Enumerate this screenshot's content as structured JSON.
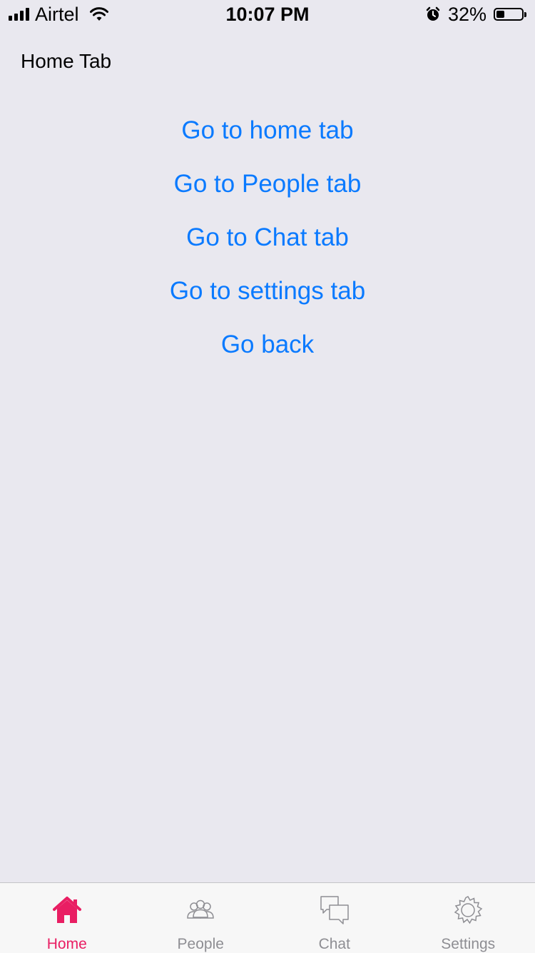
{
  "status_bar": {
    "carrier": "Airtel",
    "time": "10:07 PM",
    "battery_percent": "32%",
    "battery_level": 0.32,
    "icons": [
      "signal-icon",
      "wifi-icon",
      "alarm-icon",
      "battery-icon"
    ]
  },
  "screen": {
    "title": "Home Tab"
  },
  "links": [
    {
      "label": "Go to home tab"
    },
    {
      "label": "Go to People tab"
    },
    {
      "label": "Go to Chat tab"
    },
    {
      "label": "Go to settings tab"
    },
    {
      "label": "Go back"
    }
  ],
  "tab_bar": {
    "tabs": [
      {
        "label": "Home",
        "icon": "home-icon",
        "active": true
      },
      {
        "label": "People",
        "icon": "people-icon",
        "active": false
      },
      {
        "label": "Chat",
        "icon": "chat-icon",
        "active": false
      },
      {
        "label": "Settings",
        "icon": "gear-icon",
        "active": false
      }
    ]
  },
  "colors": {
    "background": "#e9e8ef",
    "link": "#0a7aff",
    "active_tab": "#e91e63",
    "inactive_tab": "#8e8e93"
  }
}
